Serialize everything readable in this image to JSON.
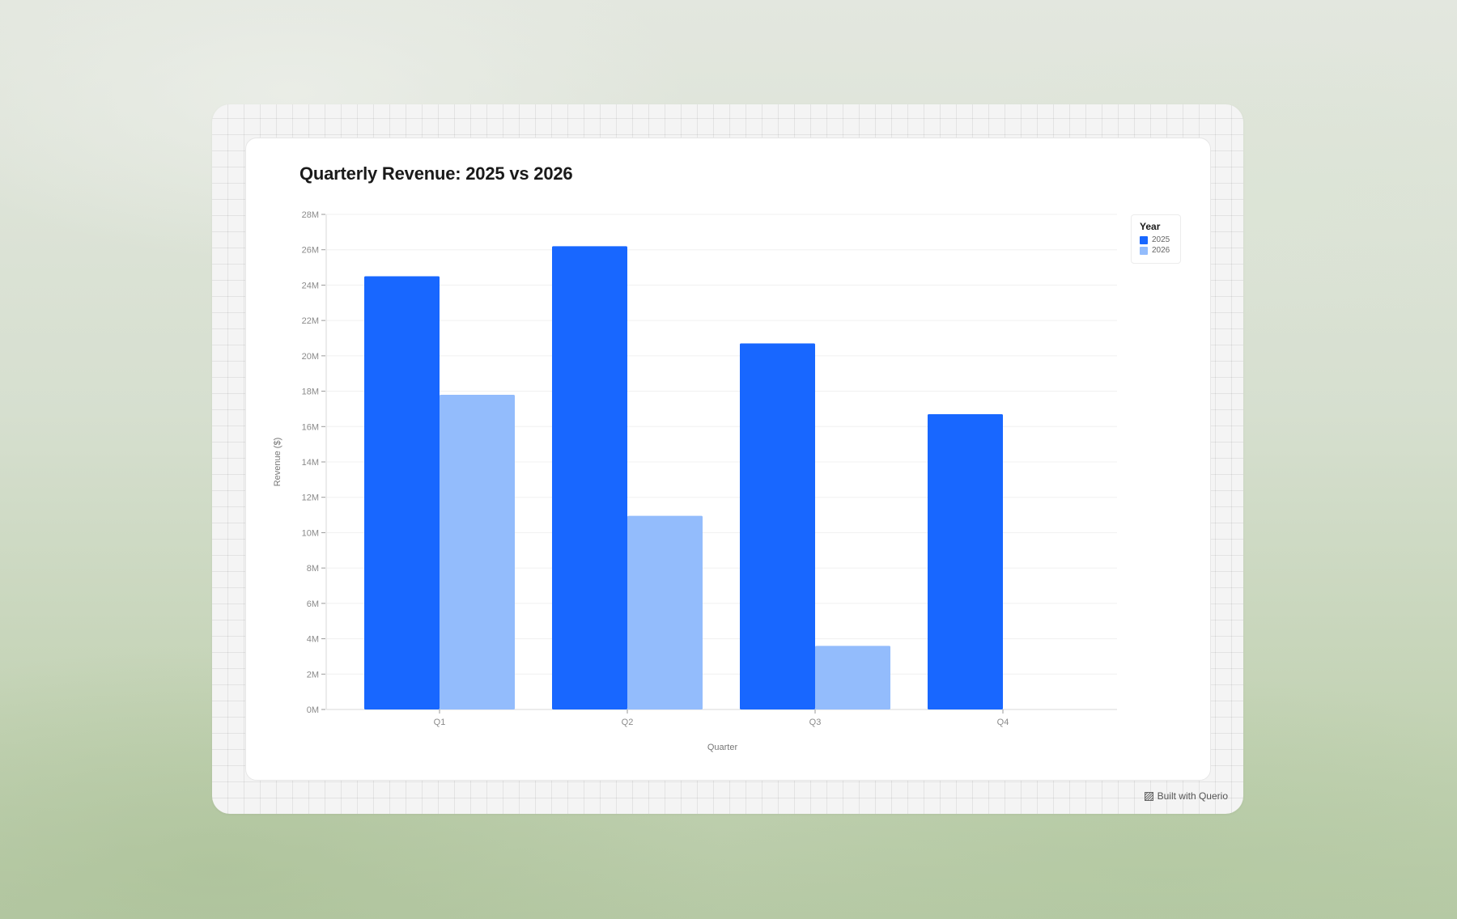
{
  "chart_data": {
    "type": "bar",
    "title": "Quarterly Revenue: 2025 vs 2026",
    "xlabel": "Quarter",
    "ylabel": "Revenue ($)",
    "categories": [
      "Q1",
      "Q2",
      "Q3",
      "Q4"
    ],
    "series": [
      {
        "name": "2025",
        "values": [
          24.5,
          26.2,
          20.7,
          16.7
        ],
        "color": "#1867ff"
      },
      {
        "name": "2026",
        "values": [
          17.8,
          10.95,
          3.6,
          null
        ],
        "color": "#93bcfc"
      }
    ],
    "value_unit": "M",
    "ylim": [
      0,
      28
    ],
    "yticks": [
      "0M",
      "2M",
      "4M",
      "6M",
      "8M",
      "10M",
      "12M",
      "14M",
      "16M",
      "18M",
      "20M",
      "22M",
      "24M",
      "26M",
      "28M"
    ],
    "grid": true,
    "legend": {
      "title": "Year",
      "position": "top-right"
    }
  },
  "footer": {
    "credit": "Built with Querio",
    "icon": "querio-logo-icon"
  },
  "colors": {
    "series_2025": "#1867ff",
    "series_2026": "#93bcfc",
    "card_background": "#ffffff",
    "frame_background": "#f4f4f4"
  }
}
